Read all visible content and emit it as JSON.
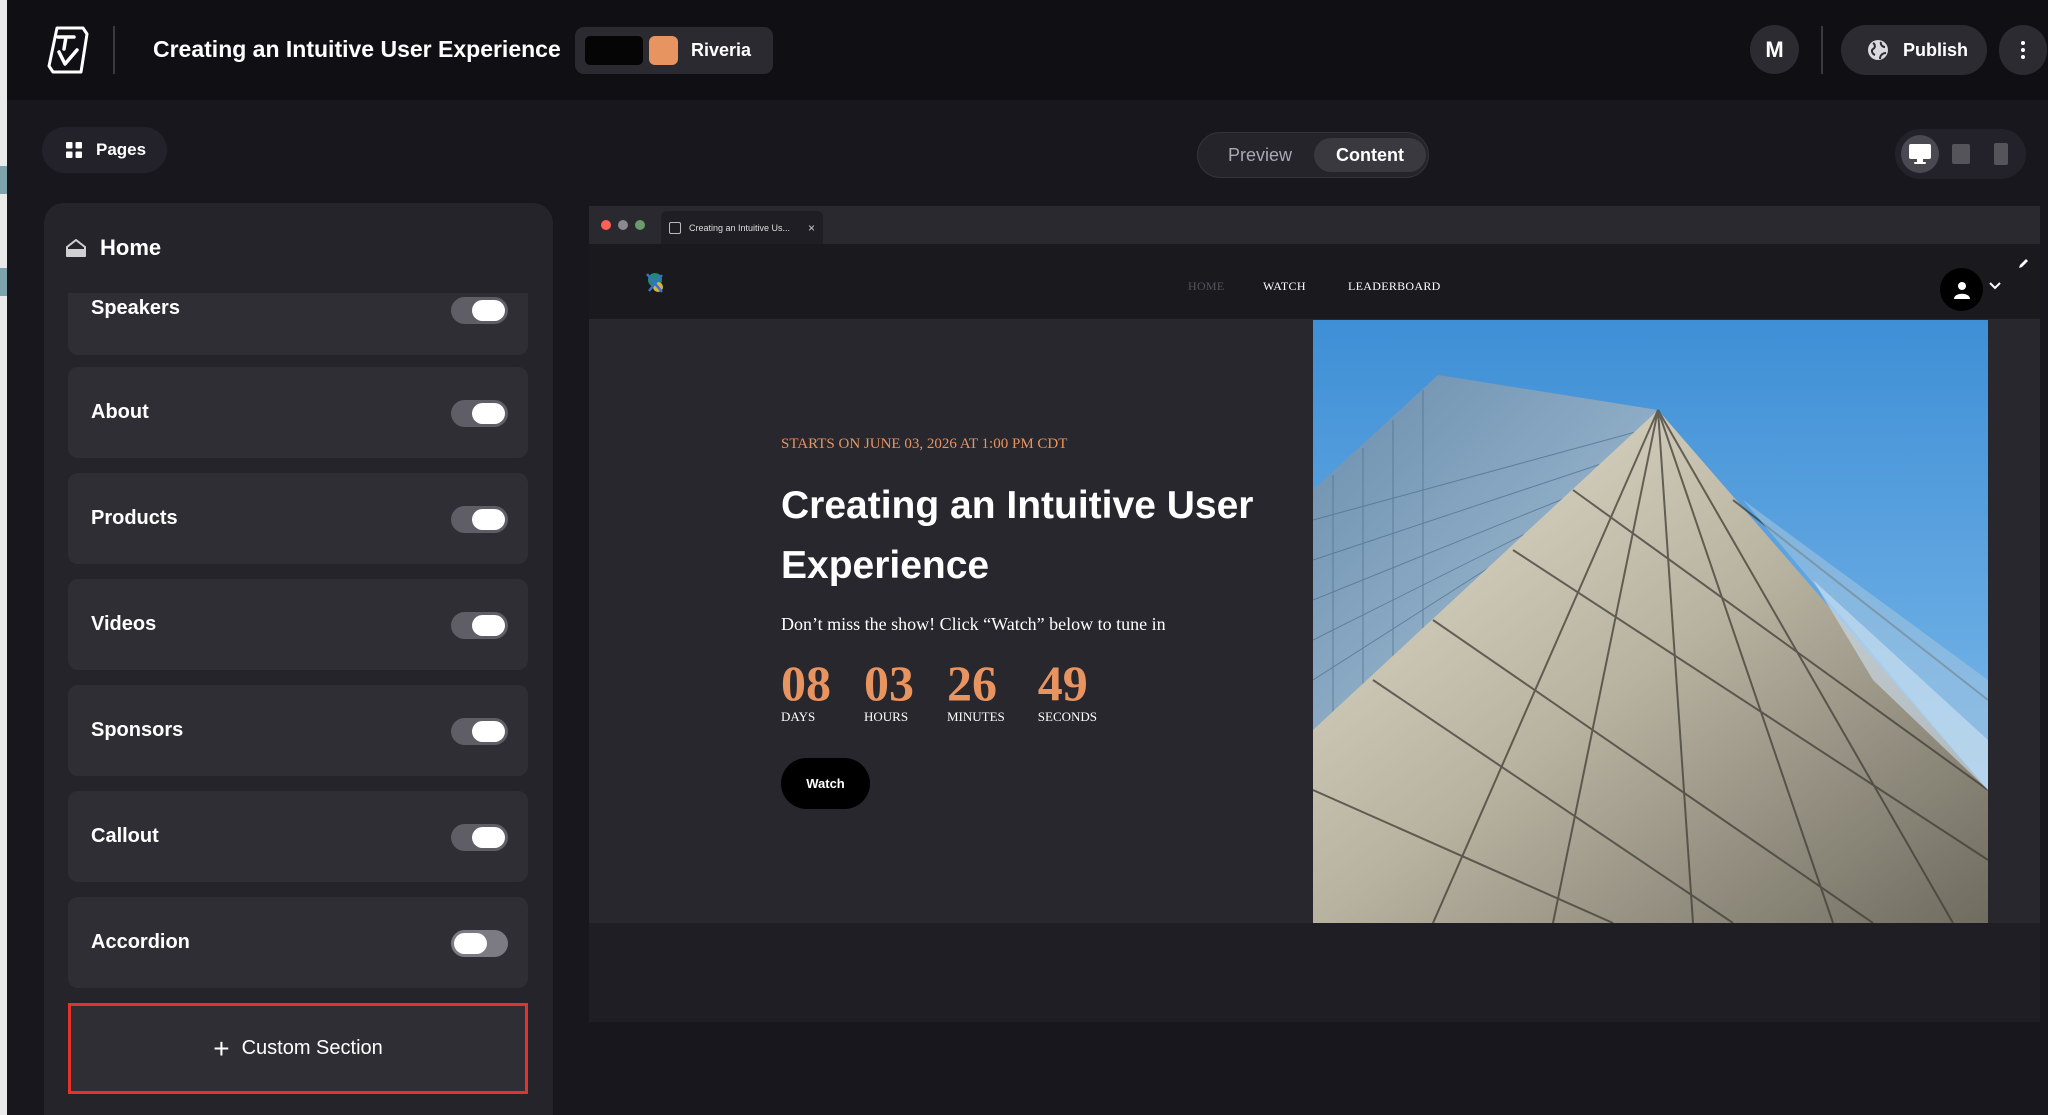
{
  "header": {
    "logo_text": "TV",
    "title": "Creating an Intuitive User Experience",
    "theme": {
      "name": "Riveria",
      "swatches": [
        "#050505",
        "#e89460"
      ]
    },
    "user_initial": "M",
    "publish_label": "Publish",
    "more_icon": "vertical-dots-icon"
  },
  "toolbar": {
    "pages_label": "Pages",
    "view_modes": [
      {
        "label": "Preview",
        "active": false
      },
      {
        "label": "Content",
        "active": true
      }
    ],
    "devices": [
      {
        "icon": "desktop-icon",
        "active": true
      },
      {
        "icon": "tablet-icon",
        "active": false
      },
      {
        "icon": "mobile-icon",
        "active": false
      }
    ]
  },
  "sidebar": {
    "page_name": "Home",
    "sections": [
      {
        "label": "Speakers",
        "enabled": true
      },
      {
        "label": "About",
        "enabled": true
      },
      {
        "label": "Products",
        "enabled": true
      },
      {
        "label": "Videos",
        "enabled": true
      },
      {
        "label": "Sponsors",
        "enabled": true
      },
      {
        "label": "Callout",
        "enabled": true
      },
      {
        "label": "Accordion",
        "enabled": false
      }
    ],
    "custom_section_label": "Custom Section"
  },
  "preview": {
    "tab_title": "Creating an Intuitive Us...",
    "nav": {
      "links": [
        {
          "label": "HOME",
          "active": true
        },
        {
          "label": "WATCH",
          "active": false
        },
        {
          "label": "LEADERBOARD",
          "active": false
        }
      ]
    },
    "hero": {
      "starts_on": "STARTS ON  JUNE 03, 2026 AT 1:00 PM CDT",
      "title": "Creating an Intuitive User Experience",
      "subtitle": "Don’t miss the show! Click “Watch” below to tune in",
      "countdown": [
        {
          "value": "08",
          "label": "DAYS"
        },
        {
          "value": "03",
          "label": "HOURS"
        },
        {
          "value": "26",
          "label": "MINUTES"
        },
        {
          "value": "49",
          "label": "SECONDS"
        }
      ],
      "watch_label": "Watch"
    }
  },
  "colors": {
    "accent": "#e89460",
    "highlight_border": "#e4332a"
  }
}
